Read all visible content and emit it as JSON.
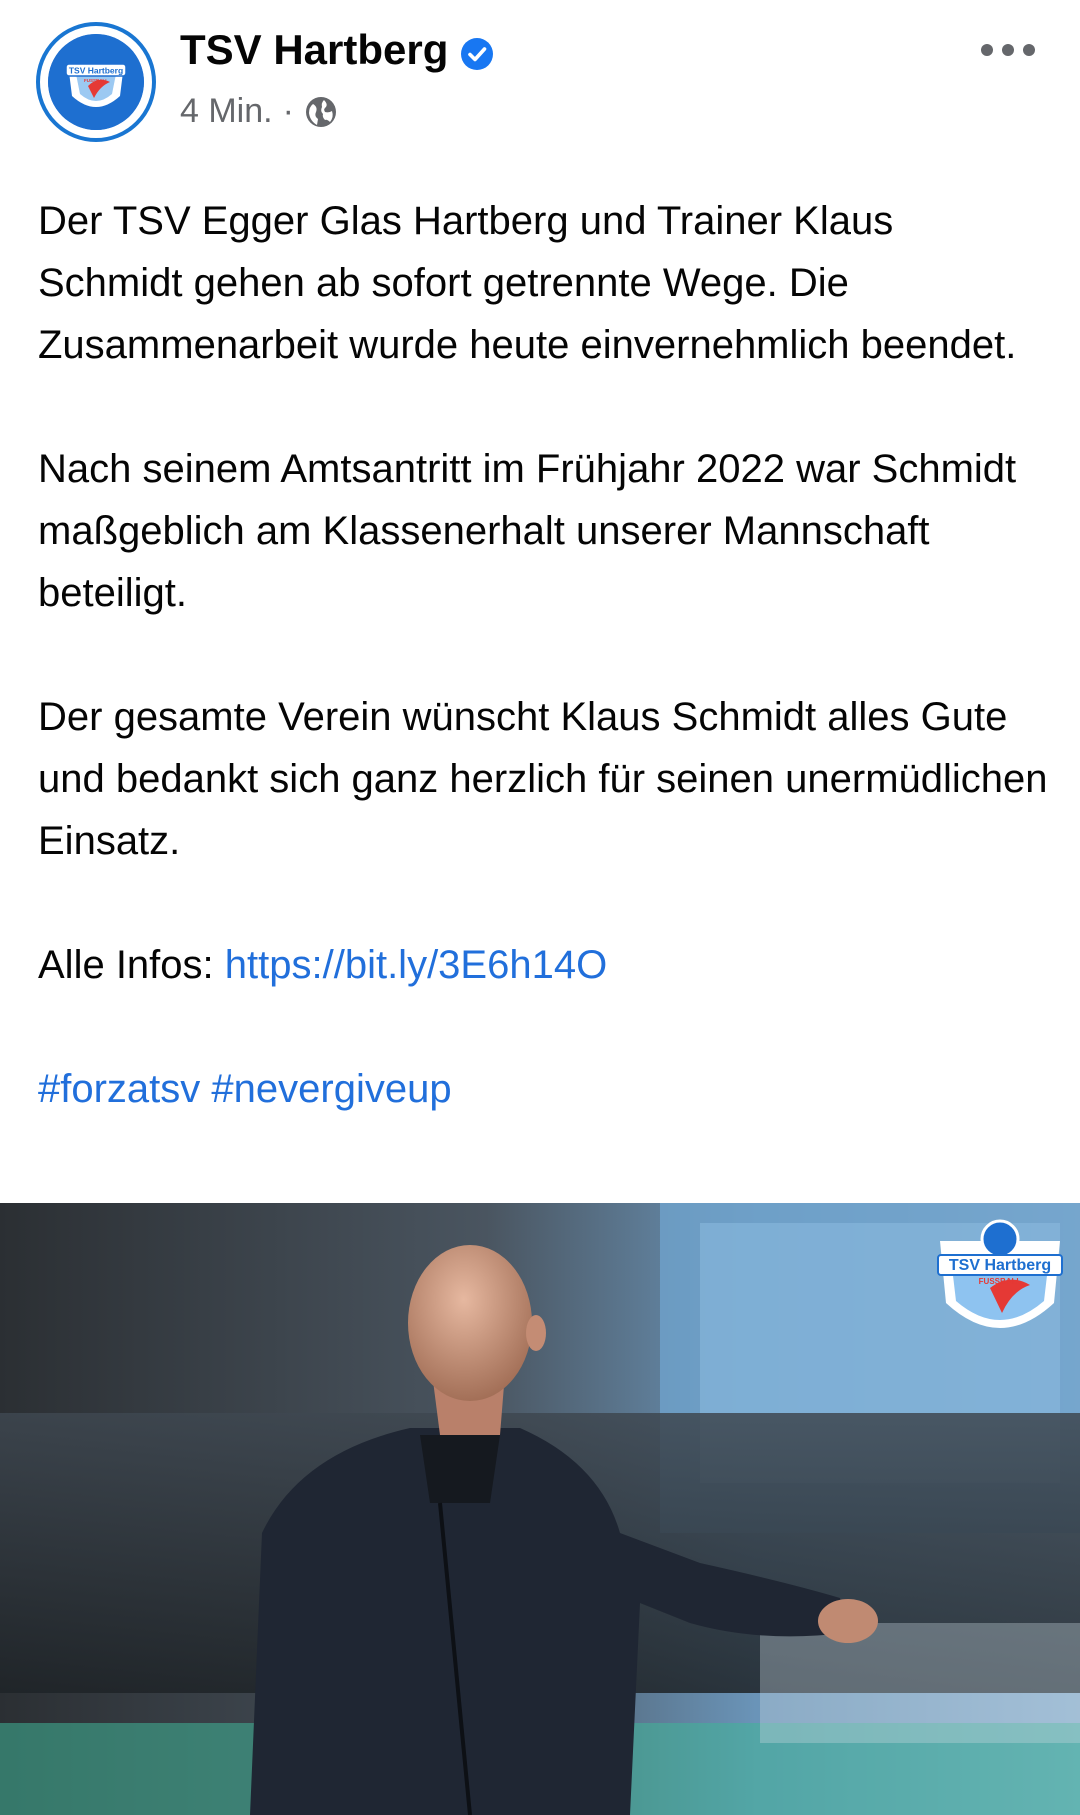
{
  "header": {
    "page_name": "TSV Hartberg",
    "verified_icon": "verified-check-icon",
    "timestamp": "4 Min.",
    "separator": "·",
    "audience_icon": "globe-icon",
    "more_icon": "more-horizontal-icon",
    "avatar_text": "TSV Hartberg",
    "avatar_subtext": "FUSSBALL"
  },
  "post": {
    "paragraph_1": "Der TSV Egger Glas Hartberg und Trainer Klaus Schmidt gehen ab sofort getrennte Wege. Die Zusammenarbeit wurde heute einvernehmlich beendet.",
    "paragraph_2": "Nach seinem Amtsantritt im Frühjahr 2022 war Schmidt maßgeblich am Klassenerhalt unserer Mannschaft beteiligt.",
    "paragraph_3": "Der gesamte Verein wünscht Klaus Schmidt alles Gute und bedankt sich ganz herzlich für seinen unermüdlichen Einsatz.",
    "infos_label": "Alle Infos: ",
    "infos_link": "https://bit.ly/3E6h14O",
    "hashtag_1": "#forzatsv",
    "hashtag_2": "#nevergiveup"
  },
  "photo": {
    "logo_text": "TSV Hartberg",
    "logo_subtext": "FUSSBALL"
  },
  "colors": {
    "link": "#216fdb",
    "meta_gray": "#65676b",
    "brand_blue": "#1976d2",
    "text": "#050505"
  }
}
